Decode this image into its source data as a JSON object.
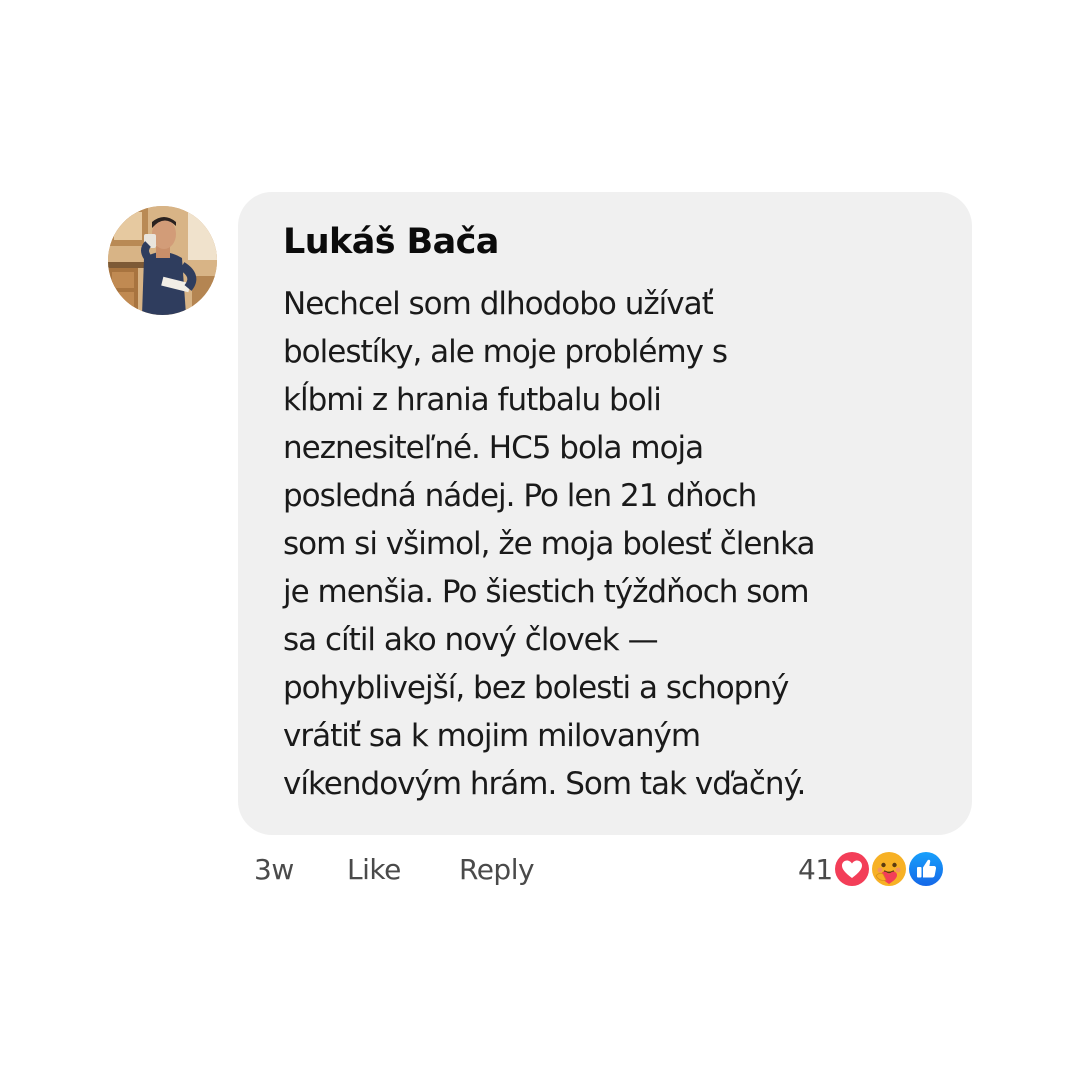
{
  "comment": {
    "author": "Lukáš Bača",
    "text": "Nechcel som dlhodobo užívať\nbolestíky, ale moje problémy s\nkĺbmi z hrania futbalu boli\nneznesiteľné. HC5 bola moja\nposledná nádej. Po len 21 dňoch\nsom si všimol, že moja bolesť členka\nje menšia. Po šiestich týždňoch som\nsa cítil ako nový človek —\npohyblivejší, bez bolesti a schopný\nvrátiť sa k mojim milovaným\nvíkendovým hrám. Som tak vďačný."
  },
  "actions": {
    "timestamp": "3w",
    "like_label": "Like",
    "reply_label": "Reply"
  },
  "reactions": {
    "count": "41",
    "icons": [
      "love-icon",
      "care-icon",
      "like-icon"
    ]
  },
  "colors": {
    "bubble": "#f0f0f0",
    "love": "#f33e58",
    "care": "#f7b125",
    "like": "#1877f2",
    "meta_text": "#4a4a4a"
  }
}
